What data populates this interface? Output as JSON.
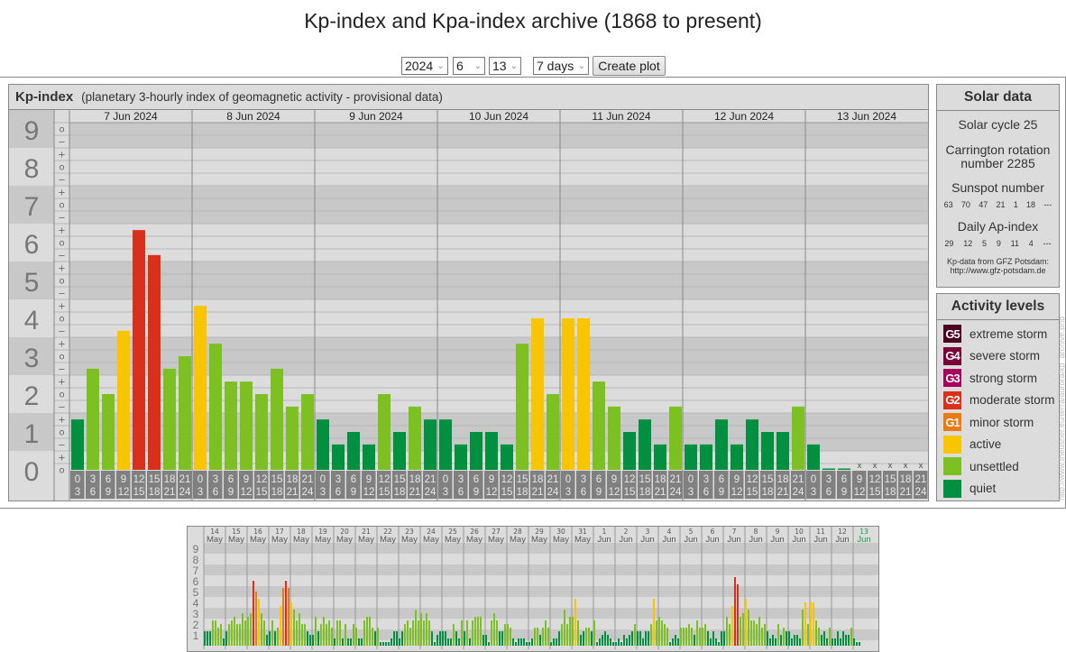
{
  "page_title": "Kp-index and Kpa-index archive (1868 to present)",
  "controls": {
    "year": "2024",
    "month": "6",
    "day": "13",
    "range": "7 days",
    "create_label": "Create plot"
  },
  "kp_panel": {
    "title": "Kp-index",
    "subtitle": "(planetary 3-hourly index of geomagnetic activity - provisional data)"
  },
  "solar": {
    "title": "Solar data",
    "cycle": "Solar cycle 25",
    "carrington_line1": "Carrington rotation",
    "carrington_line2": "number 2285",
    "sunspot_label": "Sunspot number",
    "sunspot_values": [
      "63",
      "70",
      "47",
      "21",
      "1",
      "18",
      "---"
    ],
    "ap_label": "Daily Ap-index",
    "ap_values": [
      "29",
      "12",
      "5",
      "9",
      "11",
      "4",
      "---"
    ],
    "credit_line1": "Kp-data from GFZ Potsdam:",
    "credit_line2": "http://www.gfz-potsdam.de"
  },
  "activity": {
    "title": "Activity levels",
    "levels": [
      {
        "badge": "G5",
        "label": "extreme storm",
        "color": "#4b0021"
      },
      {
        "badge": "G4",
        "label": "severe storm",
        "color": "#7a0038"
      },
      {
        "badge": "G3",
        "label": "strong storm",
        "color": "#a8005e"
      },
      {
        "badge": "G2",
        "label": "moderate storm",
        "color": "#d9301c"
      },
      {
        "badge": "G1",
        "label": "minor storm",
        "color": "#ec7a14"
      },
      {
        "badge": "",
        "label": "active",
        "color": "#f9c500"
      },
      {
        "badge": "",
        "label": "unsettled",
        "color": "#7cc022"
      },
      {
        "badge": "",
        "label": "quiet",
        "color": "#009040"
      }
    ]
  },
  "side_url": "http://www.theusner.eu/terra/aurora/kp_archive.php",
  "chart_data": [
    {
      "type": "bar",
      "title": "Kp-index",
      "ylabel": "Kp",
      "ylim": [
        0,
        9
      ],
      "y_ticks": [
        "0",
        "1",
        "2",
        "3",
        "4",
        "5",
        "6",
        "7",
        "8",
        "9"
      ],
      "interval_labels": [
        [
          "0",
          "3"
        ],
        [
          "3",
          "6"
        ],
        [
          "6",
          "9"
        ],
        [
          "9",
          "12"
        ],
        [
          "12",
          "15"
        ],
        [
          "15",
          "18"
        ],
        [
          "18",
          "21"
        ],
        [
          "21",
          "24"
        ]
      ],
      "missing_mark": "x",
      "days": [
        {
          "label": "7 Jun 2024",
          "values": [
            1.33,
            2.67,
            2,
            3.67,
            6.33,
            5.67,
            2.67,
            3
          ]
        },
        {
          "label": "8 Jun 2024",
          "values": [
            4.33,
            3.33,
            2.33,
            2.33,
            2,
            2.67,
            1.67,
            2
          ]
        },
        {
          "label": "9 Jun 2024",
          "values": [
            1.33,
            0.67,
            1,
            0.67,
            2,
            1,
            1.67,
            1.33
          ]
        },
        {
          "label": "10 Jun 2024",
          "values": [
            1.33,
            0.67,
            1,
            1,
            0.67,
            3.33,
            4,
            2
          ]
        },
        {
          "label": "11 Jun 2024",
          "values": [
            4,
            4,
            2.33,
            1.67,
            1,
            1.33,
            0.67,
            1.67
          ]
        },
        {
          "label": "12 Jun 2024",
          "values": [
            0.67,
            0.67,
            1.33,
            0.67,
            1.33,
            1,
            1,
            1.67
          ]
        },
        {
          "label": "13 Jun 2024",
          "values": [
            0.67,
            0,
            0,
            null,
            null,
            null,
            null,
            null
          ]
        }
      ]
    },
    {
      "type": "bar",
      "title": "Kp-index last 31 days",
      "ylim": [
        0,
        9
      ],
      "y_ticks": [
        "1",
        "2",
        "3",
        "4",
        "5",
        "6",
        "7",
        "8",
        "9"
      ],
      "days": [
        {
          "day": "14",
          "month": "May",
          "values": [
            1.33,
            1.33,
            1.33,
            2.33,
            2.33,
            1.67,
            2,
            0.67
          ]
        },
        {
          "day": "15",
          "month": "May",
          "values": [
            1.33,
            2,
            2.33,
            2.67,
            2,
            2,
            3,
            2.33
          ]
        },
        {
          "day": "16",
          "month": "May",
          "values": [
            2.67,
            3,
            6,
            5,
            4.33,
            3,
            2.33,
            1
          ]
        },
        {
          "day": "17",
          "month": "May",
          "values": [
            1.33,
            2.33,
            1.33,
            1.67,
            3.67,
            5.33,
            6,
            5.33
          ]
        },
        {
          "day": "18",
          "month": "May",
          "values": [
            4,
            3.33,
            2.33,
            3,
            2,
            2,
            1.33,
            1
          ]
        },
        {
          "day": "19",
          "month": "May",
          "values": [
            1,
            2.67,
            1.33,
            2,
            2.67,
            2,
            2.33,
            1.67
          ]
        },
        {
          "day": "20",
          "month": "May",
          "values": [
            0.67,
            2.33,
            2.33,
            0.67,
            2,
            0.67,
            0.67,
            2
          ]
        },
        {
          "day": "21",
          "month": "May",
          "values": [
            1.67,
            0.67,
            0.67,
            2.33,
            2.67,
            2.67,
            1.67,
            1.33
          ]
        },
        {
          "day": "22",
          "month": "May",
          "values": [
            1.67,
            0.33,
            0.33,
            0.33,
            0.33,
            0.67,
            1.33,
            1.33
          ]
        },
        {
          "day": "23",
          "month": "May",
          "values": [
            0.67,
            1.33,
            2,
            2.33,
            1.67,
            2.33,
            3.33,
            2.33
          ]
        },
        {
          "day": "24",
          "month": "May",
          "values": [
            3,
            2.33,
            3,
            2.33,
            1.33,
            0.33,
            1,
            1.33
          ]
        },
        {
          "day": "25",
          "month": "May",
          "values": [
            1.33,
            1.33,
            0.67,
            0.67,
            2,
            1.33,
            0.67,
            2.33
          ]
        },
        {
          "day": "26",
          "month": "May",
          "values": [
            1.33,
            2.33,
            0.67,
            2.33,
            2.67,
            2.67,
            2.67,
            1
          ]
        },
        {
          "day": "27",
          "month": "May",
          "values": [
            1,
            0.33,
            2.33,
            3,
            2.33,
            1.33,
            1.33,
            2
          ]
        },
        {
          "day": "28",
          "month": "May",
          "values": [
            2,
            1.67,
            0.67,
            0.33,
            0.67,
            0.67,
            0.67,
            0.33
          ]
        },
        {
          "day": "29",
          "month": "May",
          "values": [
            0.33,
            0.67,
            1.67,
            1.67,
            1,
            1.67,
            2.33,
            1.67
          ]
        },
        {
          "day": "30",
          "month": "May",
          "values": [
            0.33,
            0.67,
            0.67,
            1.33,
            2,
            3.33,
            2,
            2.67
          ]
        },
        {
          "day": "31",
          "month": "May",
          "values": [
            2.67,
            4.33,
            2.33,
            1,
            1.33,
            1.67,
            1.67,
            1.33
          ]
        },
        {
          "day": "1",
          "month": "Jun",
          "values": [
            2.33,
            0.33,
            0.67,
            1,
            1.33,
            1,
            0.67,
            0.33
          ]
        },
        {
          "day": "2",
          "month": "Jun",
          "values": [
            0.33,
            0.67,
            0.33,
            1,
            0.67,
            1,
            1.33,
            2
          ]
        },
        {
          "day": "3",
          "month": "Jun",
          "values": [
            1.33,
            1.33,
            0.67,
            1.33,
            1.33,
            2,
            4.33,
            2.33
          ]
        },
        {
          "day": "4",
          "month": "Jun",
          "values": [
            2.67,
            2.33,
            2,
            1.67,
            0.33,
            0.67,
            1,
            0.67
          ]
        },
        {
          "day": "5",
          "month": "Jun",
          "values": [
            1.67,
            1.67,
            1.67,
            2,
            1.67,
            1,
            2.33,
            1.67
          ]
        },
        {
          "day": "6",
          "month": "Jun",
          "values": [
            1.67,
            2,
            1.33,
            0.67,
            1.33,
            0.67,
            0.33,
            1.33
          ]
        },
        {
          "day": "7",
          "month": "Jun",
          "values": [
            1.33,
            2.67,
            2,
            3.67,
            6.33,
            5.67,
            2.67,
            3
          ]
        },
        {
          "day": "8",
          "month": "Jun",
          "values": [
            4.33,
            3.33,
            2.33,
            2.33,
            2,
            2.67,
            1.67,
            2
          ]
        },
        {
          "day": "9",
          "month": "Jun",
          "values": [
            1.33,
            0.67,
            1,
            0.67,
            2,
            1,
            1.67,
            1.33
          ]
        },
        {
          "day": "10",
          "month": "Jun",
          "values": [
            1.33,
            0.67,
            1,
            1,
            0.67,
            3.33,
            4,
            2
          ]
        },
        {
          "day": "11",
          "month": "Jun",
          "values": [
            4,
            4,
            2.33,
            1.67,
            1,
            1.33,
            0.67,
            1.67
          ]
        },
        {
          "day": "12",
          "month": "Jun",
          "values": [
            0.67,
            0.67,
            1.33,
            0.67,
            1.33,
            1,
            1,
            1.67
          ]
        },
        {
          "day": "13",
          "month": "Jun",
          "values": [
            0.67,
            0.33,
            0.33,
            null,
            null,
            null,
            null,
            null
          ],
          "current": true
        }
      ]
    }
  ]
}
